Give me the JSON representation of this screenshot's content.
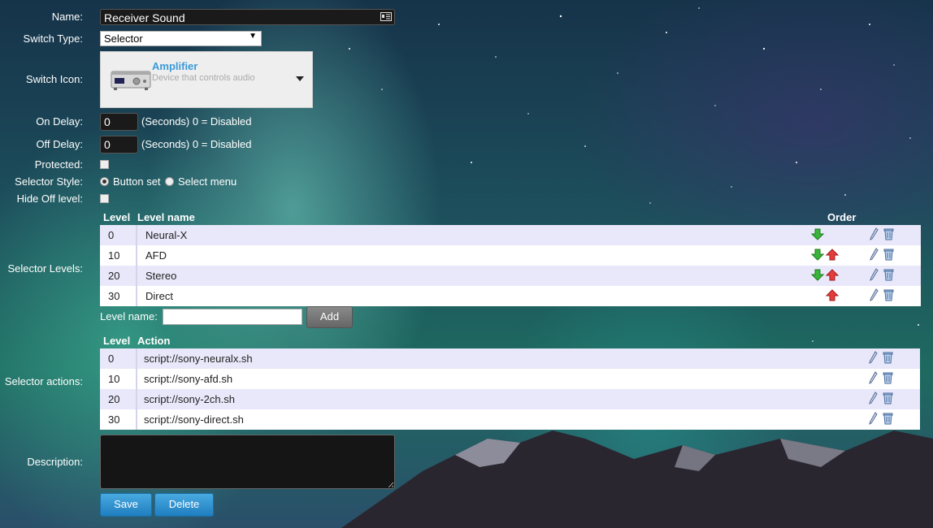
{
  "form": {
    "name_label": "Name:",
    "name_value": "Receiver Sound",
    "switch_type_label": "Switch Type:",
    "switch_type_value": "Selector",
    "switch_icon_label": "Switch Icon:",
    "icon_title": "Amplifier",
    "icon_desc": "Device that controls audio",
    "on_delay_label": "On Delay:",
    "on_delay_value": "0",
    "off_delay_label": "Off Delay:",
    "off_delay_value": "0",
    "delay_hint": "(Seconds) 0 = Disabled",
    "protected_label": "Protected:",
    "selector_style_label": "Selector Style:",
    "style_option_1": "Button set",
    "style_option_2": "Select menu",
    "hide_off_label": "Hide Off level:",
    "selector_levels_label": "Selector Levels:",
    "selector_actions_label": "Selector actions:",
    "description_label": "Description:",
    "level_name_label": "Level name:",
    "add_label": "Add",
    "save_label": "Save",
    "delete_label": "Delete"
  },
  "levels_table": {
    "col_level": "Level",
    "col_name": "Level name",
    "col_order": "Order",
    "rows": [
      {
        "level": "0",
        "name": "Neural-X",
        "down": true,
        "up": false
      },
      {
        "level": "10",
        "name": "AFD",
        "down": true,
        "up": true
      },
      {
        "level": "20",
        "name": "Stereo",
        "down": true,
        "up": true
      },
      {
        "level": "30",
        "name": "Direct",
        "down": false,
        "up": true
      }
    ]
  },
  "actions_table": {
    "col_level": "Level",
    "col_action": "Action",
    "rows": [
      {
        "level": "0",
        "action": "script://sony-neuralx.sh"
      },
      {
        "level": "10",
        "action": "script://sony-afd.sh"
      },
      {
        "level": "20",
        "action": "script://sony-2ch.sh"
      },
      {
        "level": "30",
        "action": "script://sony-direct.sh"
      }
    ]
  },
  "colors": {
    "accent_blue": "#1f7fc0",
    "row_alt": "#e8e8fa",
    "arrow_down": "#3cb43c",
    "arrow_up": "#e63c3c"
  }
}
